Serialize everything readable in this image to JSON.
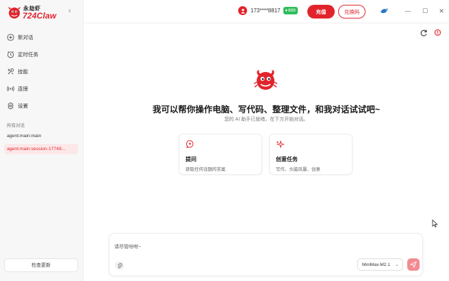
{
  "brand": {
    "name_small": "永劫虾",
    "name_big": "724Claw",
    "accent": "#e1242b"
  },
  "sidebar": {
    "items": [
      {
        "label": "新对话",
        "icon": "new-chat-icon"
      },
      {
        "label": "定时任务",
        "icon": "clock-icon"
      },
      {
        "label": "技能",
        "icon": "tools-icon"
      },
      {
        "label": "连接",
        "icon": "connection-icon"
      },
      {
        "label": "设置",
        "icon": "gear-icon"
      }
    ],
    "section_label": "所有对话",
    "chats": [
      {
        "label": "agent:main:main",
        "active": false
      },
      {
        "label": "agent:main:session-17749...",
        "active": true
      }
    ],
    "update_button": "检查更新"
  },
  "topbar": {
    "phone": "173****8817",
    "points": "899",
    "recharge_label": "充值",
    "redeem_label": "兑换码"
  },
  "main": {
    "headline": "我可以帮你操作电脑、写代码、整理文件，和我对话试试吧~",
    "subline": "您的 AI 助手已就绪，在下方开始对话。",
    "cards": [
      {
        "title": "提问",
        "desc": "获取任何话题的答案",
        "icon": "question-icon"
      },
      {
        "title": "创意任务",
        "desc": "写作、头脑风暴、创意",
        "icon": "sparkle-icon"
      }
    ]
  },
  "composer": {
    "placeholder": "请尽管吩咐~",
    "model": "MiniMax-M2.1"
  }
}
